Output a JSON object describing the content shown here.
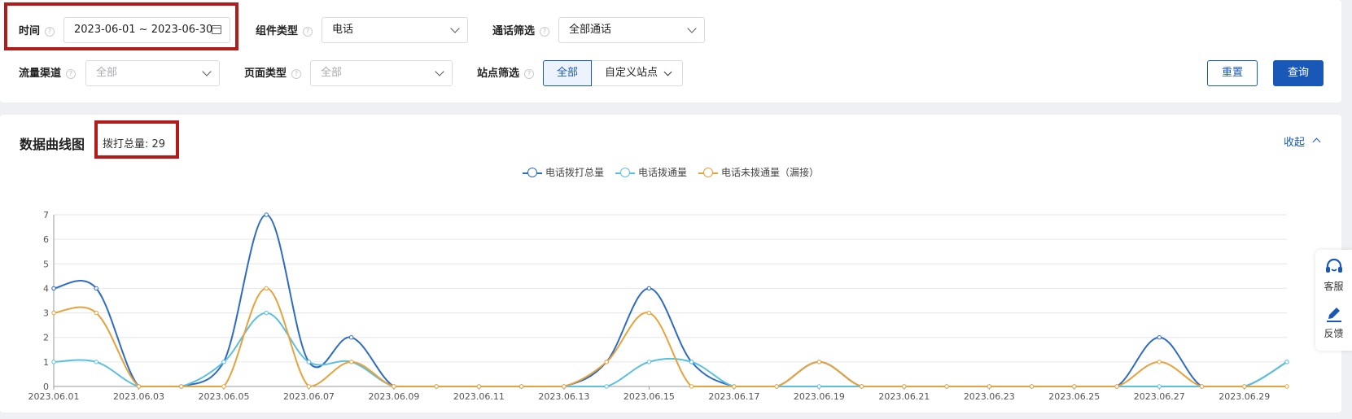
{
  "filters": {
    "time_label": "时间",
    "date_range": "2023-06-01 ~ 2023-06-30",
    "component_type_label": "组件类型",
    "component_type_value": "电话",
    "call_filter_label": "通话筛选",
    "call_filter_value": "全部通话",
    "channel_label": "流量渠道",
    "channel_placeholder": "全部",
    "page_type_label": "页面类型",
    "page_type_placeholder": "全部",
    "site_filter_label": "站点筛选",
    "site_all": "全部",
    "site_custom": "自定义站点",
    "help_icon": "question-circle-icon",
    "calendar_icon": "calendar-icon",
    "dropdown_icon": "chevron-down-icon"
  },
  "buttons": {
    "reset": "重置",
    "query": "查询"
  },
  "chart_section": {
    "title": "数据曲线图",
    "total_text": "拨打总量: 29",
    "collapse": "收起",
    "collapse_icon": "chevron-up-icon"
  },
  "side": {
    "service_label": "客服",
    "service_icon": "headset-icon",
    "feedback_label": "反馈",
    "feedback_icon": "pencil-icon",
    "accent": "#1a58b8"
  },
  "highlight_color": "#b31b1b",
  "chart_data": {
    "type": "line",
    "smooth": true,
    "legend_position": "top-center",
    "grid": true,
    "ylim": [
      0,
      7
    ],
    "yticks": [
      "0",
      "1",
      "2",
      "3",
      "4",
      "5",
      "6",
      "7"
    ],
    "x": [
      "2023.06.01",
      "2023.06.02",
      "2023.06.03",
      "2023.06.04",
      "2023.06.05",
      "2023.06.06",
      "2023.06.07",
      "2023.06.08",
      "2023.06.09",
      "2023.06.10",
      "2023.06.11",
      "2023.06.12",
      "2023.06.13",
      "2023.06.14",
      "2023.06.15",
      "2023.06.16",
      "2023.06.17",
      "2023.06.18",
      "2023.06.19",
      "2023.06.20",
      "2023.06.21",
      "2023.06.22",
      "2023.06.23",
      "2023.06.24",
      "2023.06.25",
      "2023.06.26",
      "2023.06.27",
      "2023.06.28",
      "2023.06.29",
      "2023.06.30"
    ],
    "xtick_labels": [
      "2023.06.01",
      "2023.06.03",
      "2023.06.05",
      "2023.06.07",
      "2023.06.09",
      "2023.06.11",
      "2023.06.13",
      "2023.06.15",
      "2023.06.17",
      "2023.06.19",
      "2023.06.21",
      "2023.06.23",
      "2023.06.25",
      "2023.06.27",
      "2023.06.29"
    ],
    "series": [
      {
        "name": "电话拨打总量",
        "color": "#2e6bc4",
        "values": [
          4,
          4,
          0,
          0,
          1,
          7,
          1,
          2,
          0,
          0,
          0,
          0,
          0,
          1,
          4,
          1,
          0,
          0,
          1,
          0,
          0,
          0,
          0,
          0,
          0,
          0,
          2,
          0,
          0,
          1
        ]
      },
      {
        "name": "电话拨通量",
        "color": "#5bc0de",
        "values": [
          1,
          1,
          0,
          0,
          1,
          3,
          1,
          1,
          0,
          0,
          0,
          0,
          0,
          0,
          1,
          1,
          0,
          0,
          0,
          0,
          0,
          0,
          0,
          0,
          0,
          0,
          0,
          0,
          0,
          1
        ]
      },
      {
        "name": "电话未拨通量（漏接）",
        "color": "#e6a23c",
        "values": [
          3,
          3,
          0,
          0,
          0,
          4,
          0,
          1,
          0,
          0,
          0,
          0,
          0,
          1,
          3,
          0,
          0,
          0,
          1,
          0,
          0,
          0,
          0,
          0,
          0,
          0,
          1,
          0,
          0,
          0
        ]
      }
    ]
  }
}
